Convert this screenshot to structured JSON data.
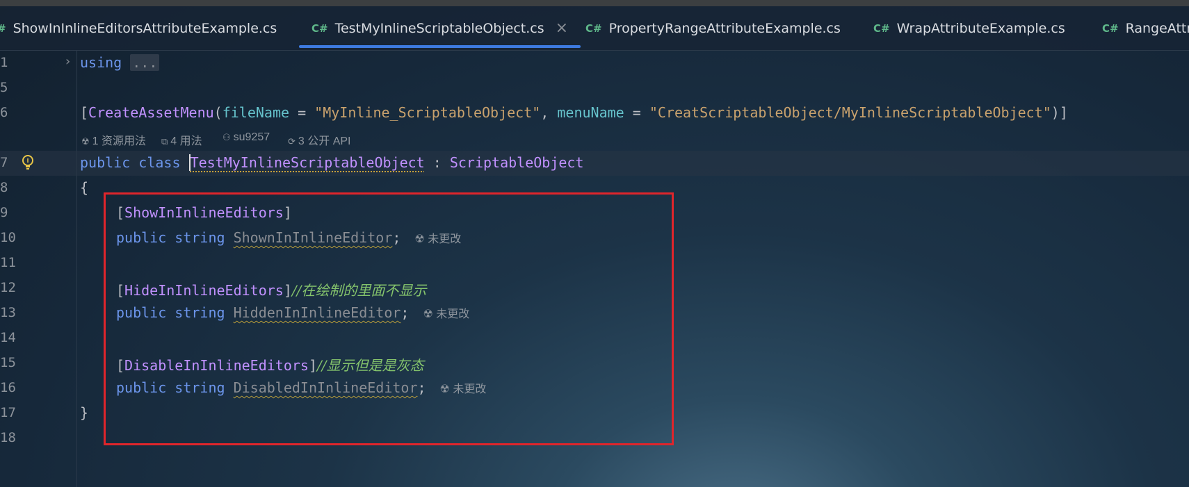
{
  "tabs": [
    {
      "icon": "#",
      "label": "ShowInInlineEditorsAttributeExample.cs"
    },
    {
      "icon": "C#",
      "label": "TestMyInlineScriptableObject.cs",
      "close": "×"
    },
    {
      "icon": "C#",
      "label": "PropertyRangeAttributeExample.cs"
    },
    {
      "icon": "C#",
      "label": "WrapAttributeExample.cs"
    },
    {
      "icon": "C#",
      "label": "RangeAttri"
    }
  ],
  "lines": {
    "l1": {
      "num": "1",
      "kw": "using",
      "fold": "..."
    },
    "l5": {
      "num": "5"
    },
    "l6": {
      "num": "6",
      "open": "[",
      "attr": "CreateAssetMenu",
      "p1": "fileName",
      "eq": " = ",
      "s1": "\"MyInline_ScriptableObject\"",
      "comma": ", ",
      "p2": "menuName",
      "s2": "\"CreatScriptableObject/MyInlineScriptableObject\"",
      "close": ")]"
    },
    "l7": {
      "num": "7",
      "kw1": "public",
      "kw2": "class",
      "name": "TestMyInlineScriptableObject",
      "colon": " : ",
      "base": "ScriptableObject"
    },
    "l8": {
      "num": "8",
      "text": "{"
    },
    "l9": {
      "num": "9",
      "attr": "ShowInInlineEditors"
    },
    "l10": {
      "num": "10",
      "kw1": "public",
      "kw2": "string",
      "field": "ShownInInlineEditor",
      "semi": ";"
    },
    "l11": {
      "num": "11"
    },
    "l12": {
      "num": "12",
      "attr": "HideInInlineEditors",
      "comment": "//在绘制的里面不显示"
    },
    "l13": {
      "num": "13",
      "kw1": "public",
      "kw2": "string",
      "field": "HiddenInInlineEditor",
      "semi": ";"
    },
    "l14": {
      "num": "14"
    },
    "l15": {
      "num": "15",
      "attr": "DisableInInlineEditors",
      "comment": "//显示但是是灰态"
    },
    "l16": {
      "num": "16",
      "kw1": "public",
      "kw2": "string",
      "field": "DisabledInInlineEditor",
      "semi": ";"
    },
    "l17": {
      "num": "17",
      "text": "}"
    },
    "l18": {
      "num": "18"
    }
  },
  "hints": {
    "usages_asset": "1 资源用法",
    "usages": "4 用法",
    "author": "su9257",
    "api": "3 公开 API",
    "unchanged": "未更改"
  },
  "colors": {
    "tab_underline": "#3d7ae0",
    "annotation_box": "#e0252b"
  }
}
